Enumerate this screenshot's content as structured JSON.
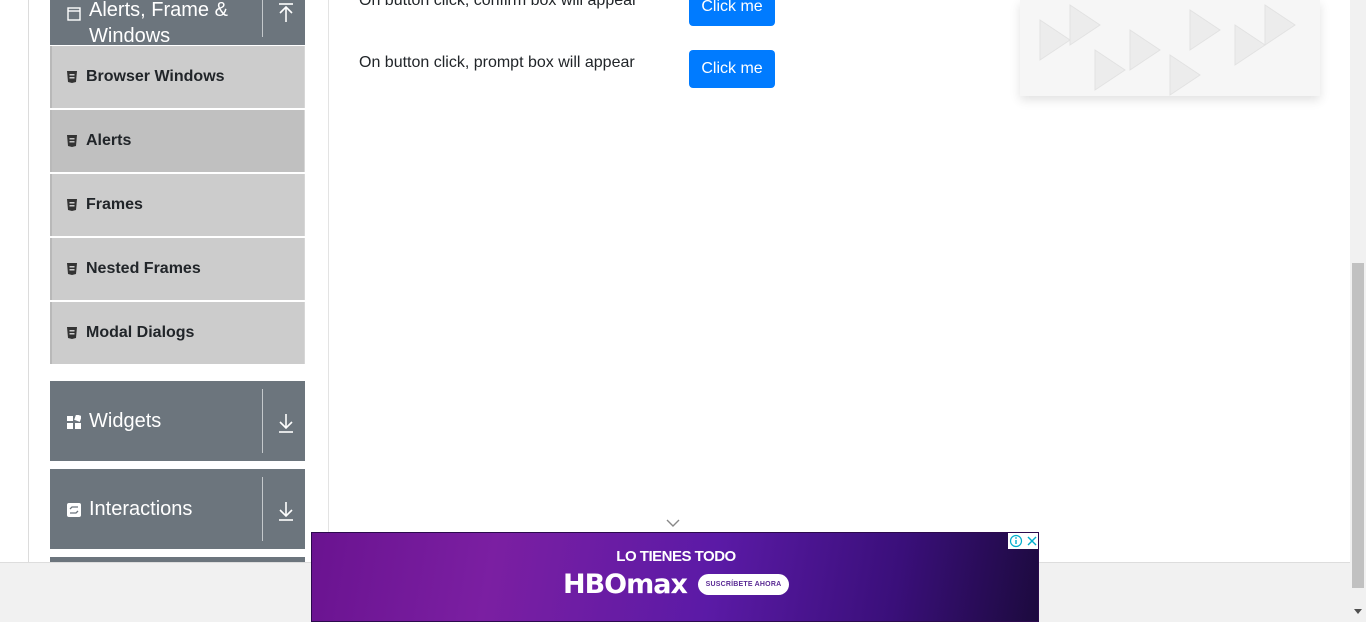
{
  "sidebar": {
    "groups": [
      {
        "label": "Alerts, Frame & Windows",
        "icon": "window-icon",
        "state": "expanded"
      },
      {
        "label": "Widgets",
        "icon": "widgets-icon",
        "state": "collapsed"
      },
      {
        "label": "Interactions",
        "icon": "interactions-icon",
        "state": "collapsed"
      }
    ],
    "items": [
      {
        "label": "Browser Windows"
      },
      {
        "label": "Alerts",
        "active": true
      },
      {
        "label": "Frames"
      },
      {
        "label": "Nested Frames"
      },
      {
        "label": "Modal Dialogs"
      }
    ]
  },
  "main": {
    "rows": [
      {
        "text": "On button click, confirm box will appear",
        "button": "Click me"
      },
      {
        "text": "On button click, prompt box will appear",
        "button": "Click me"
      }
    ]
  },
  "ad_banner": {
    "tagline": "LO TIENES TODO",
    "brand": "HBOmax",
    "cta": "SUSCRÍBETE AHORA",
    "colors": {
      "start": "#6a1390",
      "end": "#1c0a3e"
    }
  },
  "colors": {
    "primary": "#007bff",
    "group_header": "#6c757d",
    "menu_item": "#cccccc"
  }
}
